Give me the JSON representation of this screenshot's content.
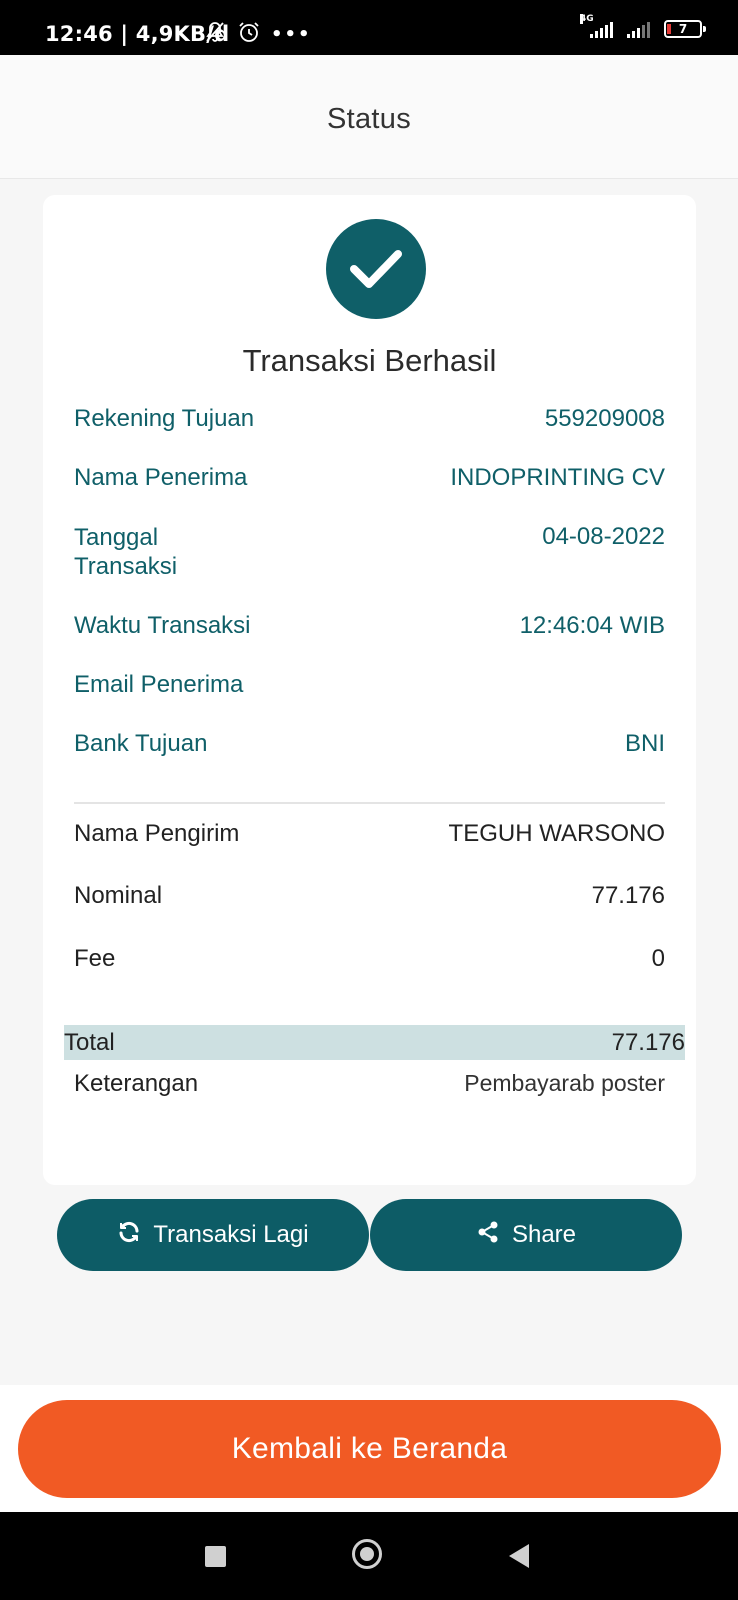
{
  "status_bar": {
    "time": "12:46",
    "network_speed": "| 4,9KB/d",
    "network_type": "4G",
    "battery_level": "7",
    "more": "•••"
  },
  "header": {
    "title": "Status"
  },
  "card": {
    "title": "Transaksi Berhasil",
    "details": [
      {
        "label": "Rekening Tujuan",
        "value": "559209008"
      },
      {
        "label": "Nama Penerima",
        "value": "INDOPRINTING CV"
      },
      {
        "label": "Tanggal Transaksi",
        "value": "04-08-2022"
      },
      {
        "label": "Waktu Transaksi",
        "value": "12:46:04 WIB"
      },
      {
        "label": "Email Penerima",
        "value": ""
      },
      {
        "label": "Bank Tujuan",
        "value": "BNI"
      }
    ],
    "summary": [
      {
        "label": "Nama Pengirim",
        "value": "TEGUH WARSONO"
      },
      {
        "label": "Nominal",
        "value": "77.176"
      },
      {
        "label": "Fee",
        "value": "0"
      }
    ],
    "total": {
      "label": "Total",
      "value": "77.176"
    },
    "note": {
      "label": "Keterangan",
      "value": "Pembayarab poster"
    }
  },
  "actions": {
    "again_label": "Transaksi Lagi",
    "share_label": "Share"
  },
  "home_button": {
    "label": "Kembali ke Beranda"
  },
  "colors": {
    "teal": "#0f5f68",
    "orange": "#f15a24",
    "total_bg": "#cde0e1"
  }
}
